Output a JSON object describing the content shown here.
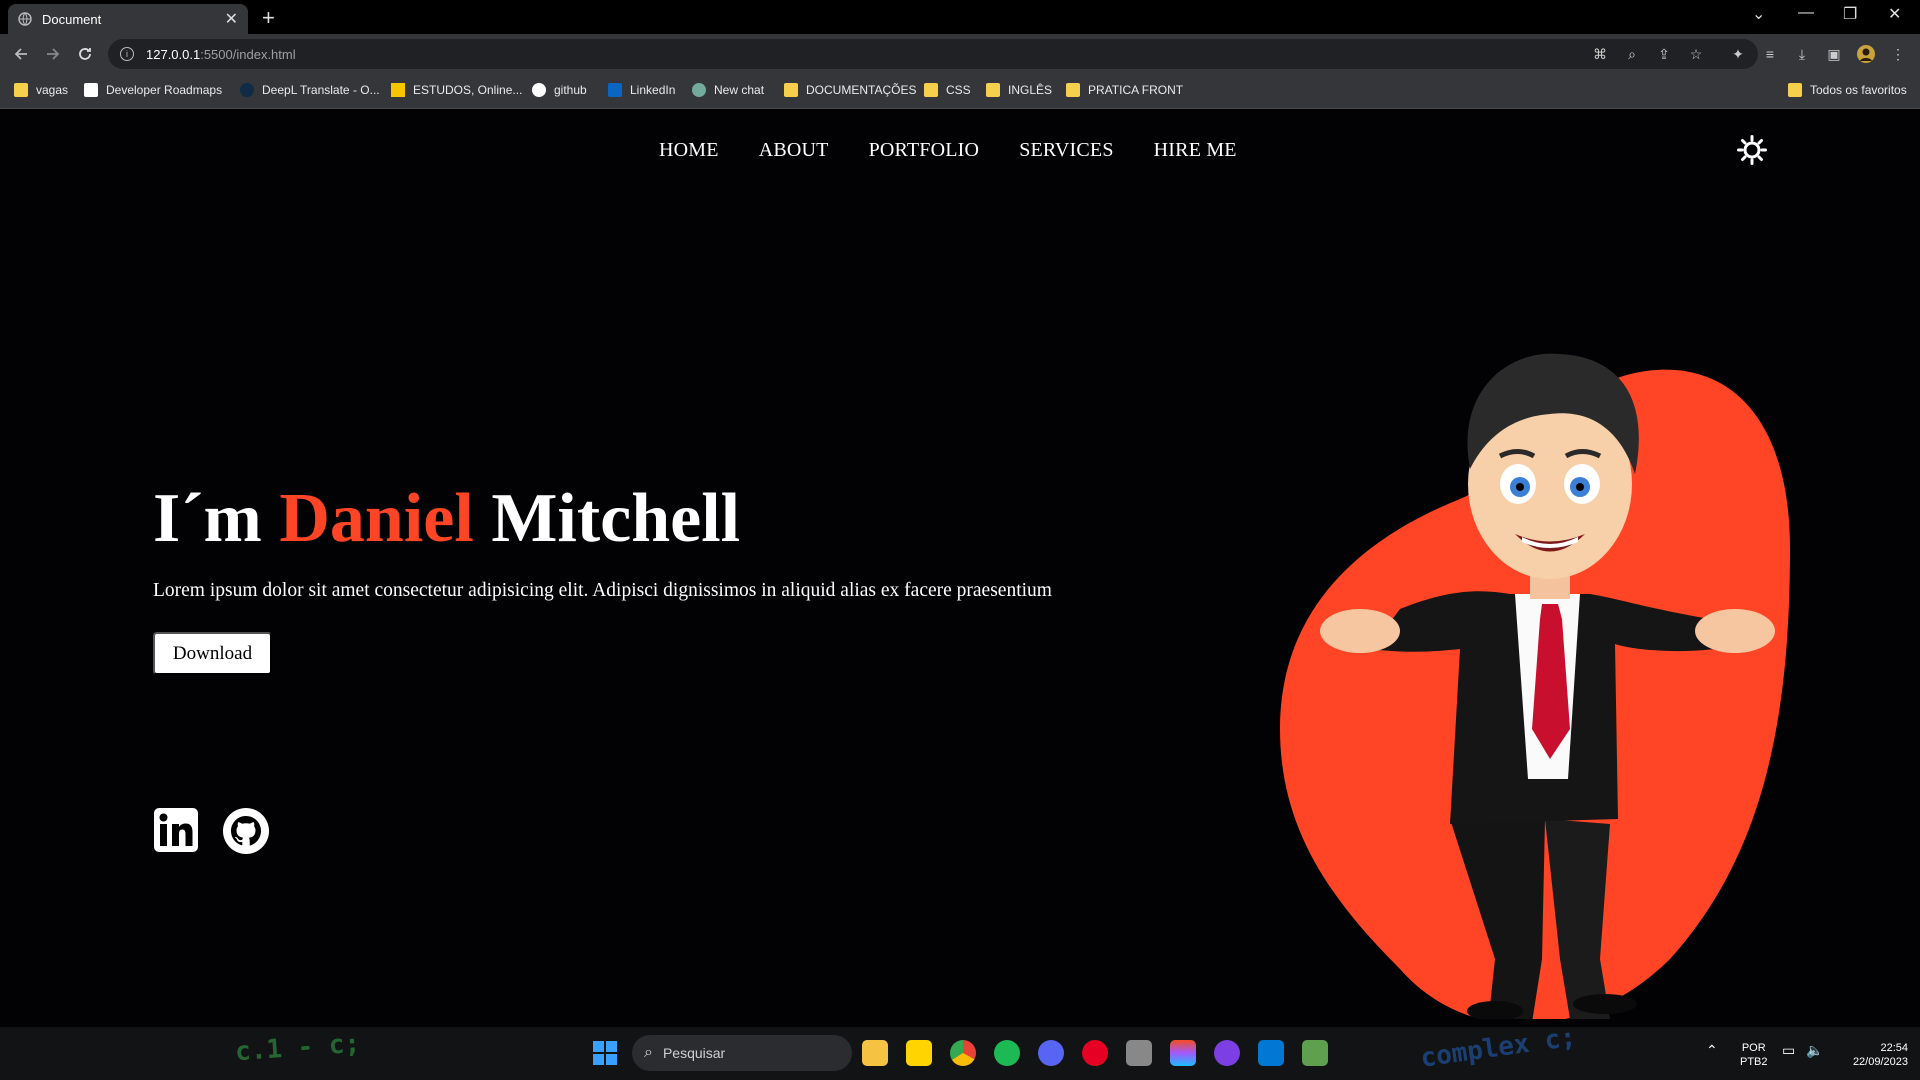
{
  "browser": {
    "tab_title": "Document",
    "url_host": "127.0.0.1",
    "url_path": ":5500/index.html",
    "bookmarks": [
      "vagas",
      "Developer Roadmaps",
      "DeepL Translate - O...",
      "ESTUDOS, Online...",
      "github",
      "LinkedIn",
      "New chat",
      "DOCUMENTAÇÕES",
      "CSS",
      "INGLÊS",
      "PRATICA FRONT"
    ],
    "all_bookmarks": "Todos os favoritos"
  },
  "nav": {
    "items": [
      "HOME",
      "ABOUT",
      "PORTFOLIO",
      "SERVICES",
      "HIRE ME"
    ]
  },
  "hero": {
    "title_prefix": "I´m ",
    "title_accent": "Daniel",
    "title_suffix": " Mitchell",
    "description": "Lorem ipsum dolor sit amet consectetur adipisicing elit. Adipisci dignissimos in aliquid alias ex facere praesentium",
    "download_label": "Download"
  },
  "colors": {
    "accent": "#ff4525",
    "background": "#020205"
  },
  "icons": [
    "sun-icon",
    "linkedin-icon",
    "github-icon"
  ],
  "taskbar": {
    "search_placeholder": "Pesquisar",
    "lang_top": "POR",
    "lang_bottom": "PTB2",
    "time": "22:54",
    "date": "22/09/2023"
  }
}
